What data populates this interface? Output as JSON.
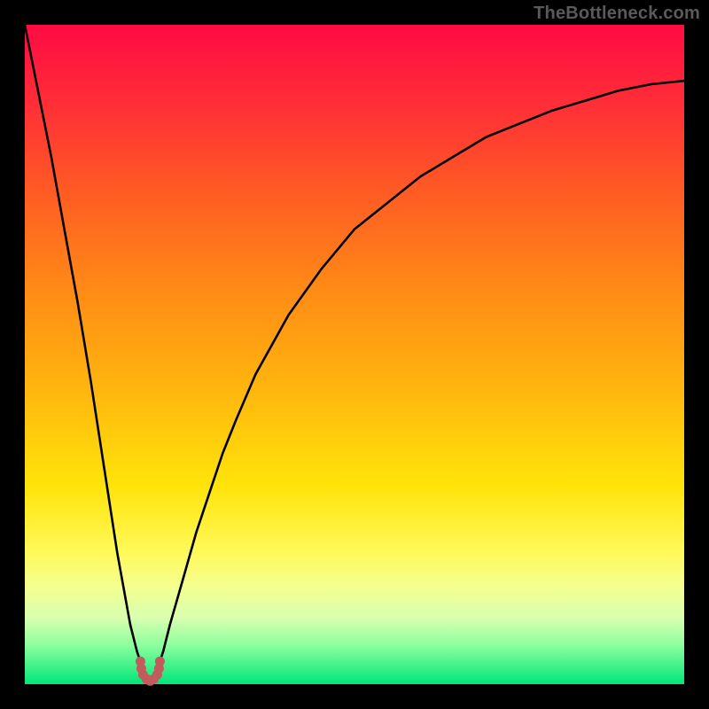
{
  "watermark": "TheBottleneck.com",
  "colors": {
    "frame": "#000000",
    "gradient_top": "#ff0a44",
    "gradient_bottom": "#00e57a",
    "curve": "#000000",
    "marker": "#c25b5b"
  },
  "chart_data": {
    "type": "line",
    "title": "",
    "xlabel": "",
    "ylabel": "",
    "xlim": [
      0,
      100
    ],
    "ylim": [
      0,
      100
    ],
    "note": "Values approximated from unlabeled axes; 0=bottom/left, 100=top/right. Y is a cusp curve with minimum near x≈19.",
    "series": [
      {
        "name": "curve",
        "x": [
          0,
          2,
          4,
          6,
          8,
          10,
          12,
          14,
          16,
          17,
          18,
          18.5,
          19,
          19.5,
          20,
          21,
          22,
          24,
          26,
          28,
          30,
          32,
          35,
          40,
          45,
          50,
          55,
          60,
          65,
          70,
          75,
          80,
          85,
          90,
          95,
          100
        ],
        "values": [
          100,
          90,
          80,
          69,
          58,
          46,
          33,
          20,
          9,
          5,
          2,
          0.8,
          0.5,
          0.8,
          2,
          5,
          9,
          16,
          23,
          29,
          35,
          40,
          47,
          56,
          63,
          69,
          73,
          77,
          80,
          83,
          85,
          87,
          88.5,
          90,
          91,
          91.5
        ]
      }
    ],
    "markers": [
      {
        "name": "bottom-cluster",
        "x": 19,
        "y": 0.5,
        "color": "#c25b5b"
      }
    ]
  }
}
